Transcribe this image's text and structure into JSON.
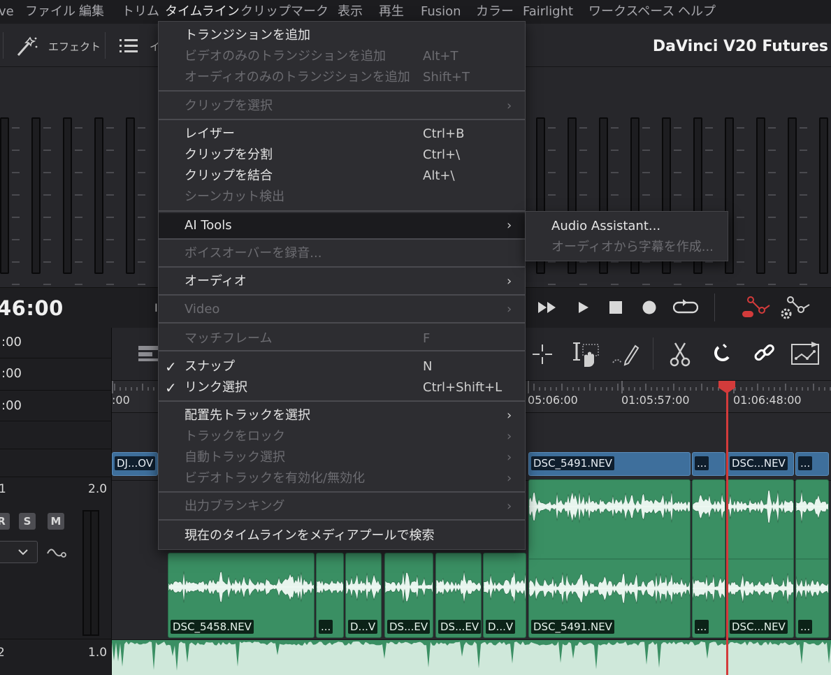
{
  "menubar": {
    "items": [
      "ve",
      "ファイル",
      "編集",
      "トリム",
      "タイムライン",
      "クリップ",
      "マーク",
      "表示",
      "再生",
      "Fusion",
      "カラー",
      "Fairlight",
      "ワークスペース",
      "ヘルプ"
    ],
    "active_item": "タイムライン"
  },
  "toolbar": {
    "effect_label": "エフェクト",
    "index_partial": "イ",
    "project_title": "DaVinci V20 Futures"
  },
  "transport": {
    "timecode": "46:00",
    "partial_char": "I"
  },
  "left_panel": {
    "rows": [
      ":00",
      ":00",
      ":00"
    ],
    "track1_label": "1",
    "track1_gain": "2.0",
    "btn_r": "R",
    "btn_s": "S",
    "btn_m": "M",
    "track2_label": "2",
    "track2_gain": "1.0"
  },
  "timeline": {
    "ruler_labels": [
      ":00",
      "05:06:00",
      "01:05:57:00",
      "01:06:48:00"
    ],
    "video_clips": [
      "DJ...OV",
      "DSC_5491.NEV",
      "...",
      "DSC...NEV",
      "..."
    ],
    "audio_clips": [
      "DSC_5458.NEV",
      "...",
      "D...V",
      "DS...EV",
      "DS...EV",
      "D...V",
      "DSC_5491.NEV",
      "...",
      "DSC...NEV",
      "..."
    ]
  },
  "dropdown": {
    "items": [
      {
        "label": "トランジションを追加",
        "shortcut": "",
        "disabled": false,
        "submenu": false,
        "checked": false
      },
      {
        "label": "ビデオのみのトランジションを追加",
        "shortcut": "Alt+T",
        "disabled": true,
        "submenu": false,
        "checked": false
      },
      {
        "label": "オーディオのみのトランジションを追加",
        "shortcut": "Shift+T",
        "disabled": true,
        "submenu": false,
        "checked": false
      },
      {
        "label": "クリップを選択",
        "shortcut": "",
        "disabled": true,
        "submenu": true,
        "checked": false
      },
      {
        "label": "レイザー",
        "shortcut": "Ctrl+B",
        "disabled": false,
        "submenu": false,
        "checked": false
      },
      {
        "label": "クリップを分割",
        "shortcut": "Ctrl+\\",
        "disabled": false,
        "submenu": false,
        "checked": false
      },
      {
        "label": "クリップを結合",
        "shortcut": "Alt+\\",
        "disabled": false,
        "submenu": false,
        "checked": false
      },
      {
        "label": "シーンカット検出",
        "shortcut": "",
        "disabled": true,
        "submenu": false,
        "checked": false
      },
      {
        "label": "AI Tools",
        "shortcut": "",
        "disabled": false,
        "submenu": true,
        "checked": false,
        "highlighted": true
      },
      {
        "label": "ボイスオーバーを録音...",
        "shortcut": "",
        "disabled": true,
        "submenu": false,
        "checked": false
      },
      {
        "label": "オーディオ",
        "shortcut": "",
        "disabled": false,
        "submenu": true,
        "checked": false
      },
      {
        "label": "Video",
        "shortcut": "",
        "disabled": true,
        "submenu": true,
        "checked": false
      },
      {
        "label": "マッチフレーム",
        "shortcut": "F",
        "disabled": true,
        "submenu": false,
        "checked": false
      },
      {
        "label": "スナップ",
        "shortcut": "N",
        "disabled": false,
        "submenu": false,
        "checked": true
      },
      {
        "label": "リンク選択",
        "shortcut": "Ctrl+Shift+L",
        "disabled": false,
        "submenu": false,
        "checked": true
      },
      {
        "label": "配置先トラックを選択",
        "shortcut": "",
        "disabled": false,
        "submenu": true,
        "checked": false
      },
      {
        "label": "トラックをロック",
        "shortcut": "",
        "disabled": true,
        "submenu": true,
        "checked": false
      },
      {
        "label": "自動トラック選択",
        "shortcut": "",
        "disabled": true,
        "submenu": true,
        "checked": false
      },
      {
        "label": "ビデオトラックを有効化/無効化",
        "shortcut": "",
        "disabled": true,
        "submenu": true,
        "checked": false
      },
      {
        "label": "出力ブランキング",
        "shortcut": "",
        "disabled": true,
        "submenu": true,
        "checked": false
      },
      {
        "label": "現在のタイムラインをメディアプールで検索",
        "shortcut": "",
        "disabled": false,
        "submenu": false,
        "checked": false
      }
    ],
    "submenu_glyph": "›",
    "check_glyph": "✓"
  },
  "ai_submenu": {
    "items": [
      {
        "label": "Audio Assistant...",
        "disabled": false
      },
      {
        "label": "オーディオから字幕を作成...",
        "disabled": true
      }
    ]
  },
  "colors": {
    "accent_red": "#d33b3b",
    "video_clip": "#3e6f9c",
    "audio_clip": "#3a8f63"
  }
}
